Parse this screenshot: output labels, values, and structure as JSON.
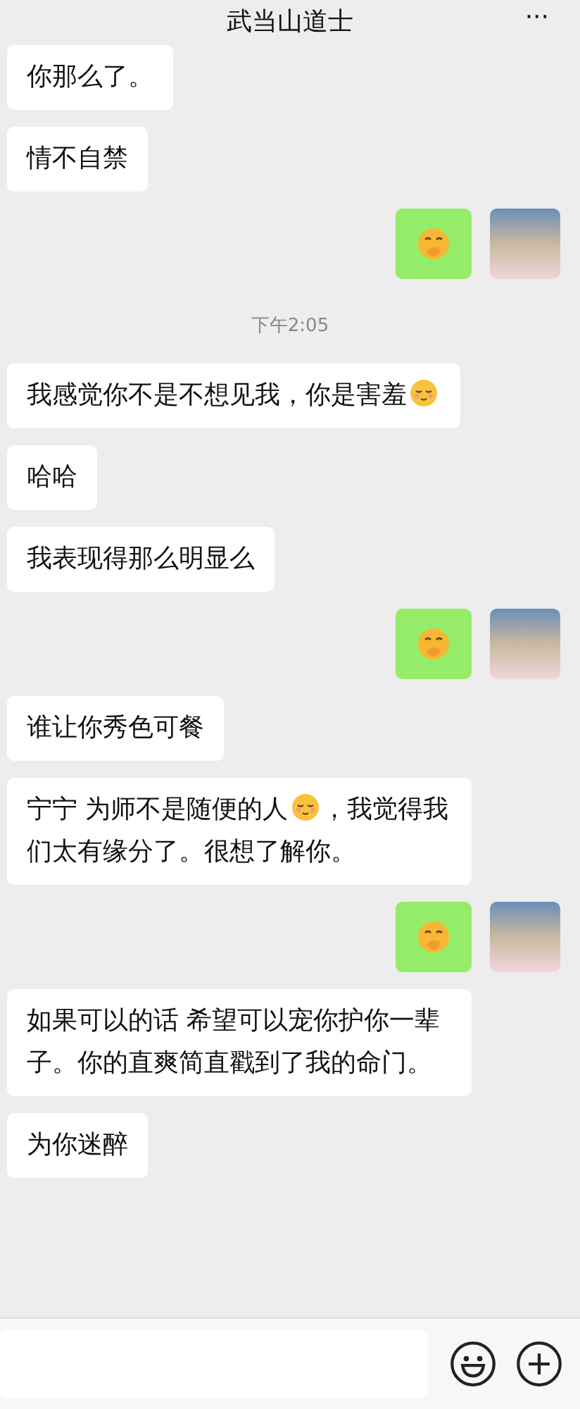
{
  "header": {
    "title": "武当山道士",
    "menu": "···"
  },
  "messages": [
    {
      "kind": "received",
      "parts": [
        {
          "kind": "text",
          "text": "你那么了。"
        }
      ]
    },
    {
      "kind": "received",
      "parts": [
        {
          "kind": "text",
          "text": "情不自禁"
        }
      ]
    },
    {
      "kind": "sent_sticker"
    },
    {
      "kind": "time",
      "text": "下午2:05"
    },
    {
      "kind": "received",
      "parts": [
        {
          "kind": "text",
          "text": "我感觉你不是不想见我，你是害羞"
        },
        {
          "kind": "emoji"
        }
      ]
    },
    {
      "kind": "received",
      "parts": [
        {
          "kind": "text",
          "text": "哈哈"
        }
      ]
    },
    {
      "kind": "received",
      "parts": [
        {
          "kind": "text",
          "text": "我表现得那么明显么"
        }
      ]
    },
    {
      "kind": "sent_sticker"
    },
    {
      "kind": "received",
      "parts": [
        {
          "kind": "text",
          "text": "谁让你秀色可餐"
        }
      ]
    },
    {
      "kind": "received",
      "parts": [
        {
          "kind": "text",
          "text": "宁宁 为师不是随便的人"
        },
        {
          "kind": "emoji"
        },
        {
          "kind": "text",
          "text": "，我觉得我们太有缘分了。很想了解你。"
        }
      ]
    },
    {
      "kind": "sent_sticker"
    },
    {
      "kind": "received",
      "parts": [
        {
          "kind": "text",
          "text": "如果可以的话 希望可以宠你护你一辈子。你的直爽简直戳到了我的命门。"
        }
      ]
    },
    {
      "kind": "received",
      "parts": [
        {
          "kind": "text",
          "text": "为你迷醉"
        }
      ]
    }
  ]
}
